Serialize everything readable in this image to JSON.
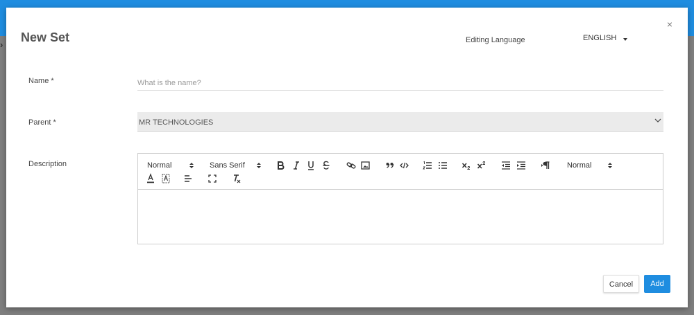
{
  "dialog": {
    "title": "New Set",
    "close_symbol": "×",
    "editing_language_label": "Editing Language",
    "language_value": "ENGLISH"
  },
  "form": {
    "name_label": "Name *",
    "name_placeholder": "What is the name?",
    "name_value": "",
    "parent_label": "Parent *",
    "parent_value": "MR TECHNOLOGIES",
    "description_label": "Description"
  },
  "toolbar": {
    "header_picker": "Normal",
    "font_picker": "Sans Serif",
    "size_picker": "Normal",
    "icons": [
      "bold-icon",
      "italic-icon",
      "underline-icon",
      "strike-icon",
      "link-icon",
      "image-icon",
      "blockquote-icon",
      "code-block-icon",
      "ordered-list-icon",
      "bullet-list-icon",
      "subscript-icon",
      "superscript-icon",
      "outdent-icon",
      "indent-icon",
      "text-direction-icon",
      "font-color-icon",
      "background-color-icon",
      "align-icon",
      "fullscreen-icon",
      "clear-format-icon"
    ]
  },
  "actions": {
    "cancel_label": "Cancel",
    "add_label": "Add"
  },
  "colors": {
    "primary": "#1f8de0",
    "parent_bg": "#ebebeb"
  }
}
